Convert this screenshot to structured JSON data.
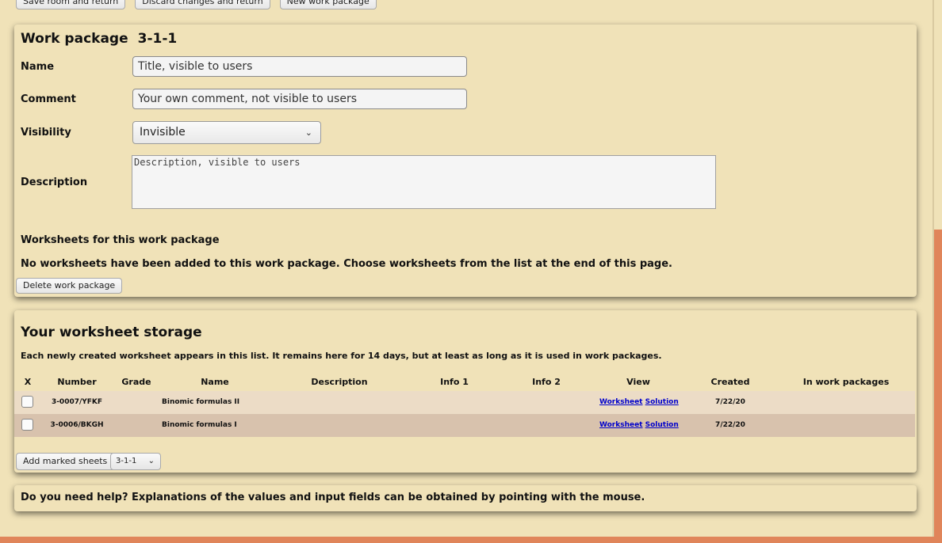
{
  "top_buttons": {
    "save": "Save room and return",
    "discard": "Discard changes and return",
    "new_package": "New work package"
  },
  "work_package": {
    "title": "Work package",
    "number": "3-1-1",
    "name_label": "Name",
    "name_placeholder": "Title, visible to users",
    "comment_label": "Comment",
    "comment_placeholder": "Your own comment, not visible to users",
    "visibility_label": "Visibility",
    "visibility_value": "Invisible",
    "description_label": "Description",
    "description_placeholder": "Description, visible to users",
    "worksheets_heading": "Worksheets for this work package",
    "no_worksheets_msg": "No worksheets have been added to this work package. Choose worksheets from the list at the end of this page.",
    "delete_button": "Delete work package"
  },
  "storage": {
    "title": "Your worksheet storage",
    "info": "Each newly created worksheet appears in this list. It remains here for 14 days, but at least as long as it is used in work packages.",
    "columns": {
      "x": "X",
      "number": "Number",
      "grade": "Grade",
      "name": "Name",
      "description": "Description",
      "info1": "Info 1",
      "info2": "Info 2",
      "view": "View",
      "created": "Created",
      "in_packages": "In work packages"
    },
    "rows": [
      {
        "number": "3-0007/YFKF",
        "grade": "",
        "name": "Binomic formulas II",
        "description": "",
        "info1": "",
        "info2": "",
        "worksheet_link": "Worksheet",
        "solution_link": "Solution",
        "created": "7/22/20",
        "in_packages": ""
      },
      {
        "number": "3-0006/BKGH",
        "grade": "",
        "name": "Binomic formulas I",
        "description": "",
        "info1": "",
        "info2": "",
        "worksheet_link": "Worksheet",
        "solution_link": "Solution",
        "created": "7/22/20",
        "in_packages": ""
      }
    ],
    "add_button": "Add marked sheets to",
    "target_value": "3-1-1"
  },
  "help": {
    "text": "Do you need help? Explanations of the values and input fields can be obtained by pointing with the mouse."
  },
  "colors": {
    "background": "#f0e2b8",
    "row_light": "#ecdcc6",
    "row_dark": "#d8c2ad",
    "accent_strip": "#e0855a",
    "link": "#0000cc"
  }
}
